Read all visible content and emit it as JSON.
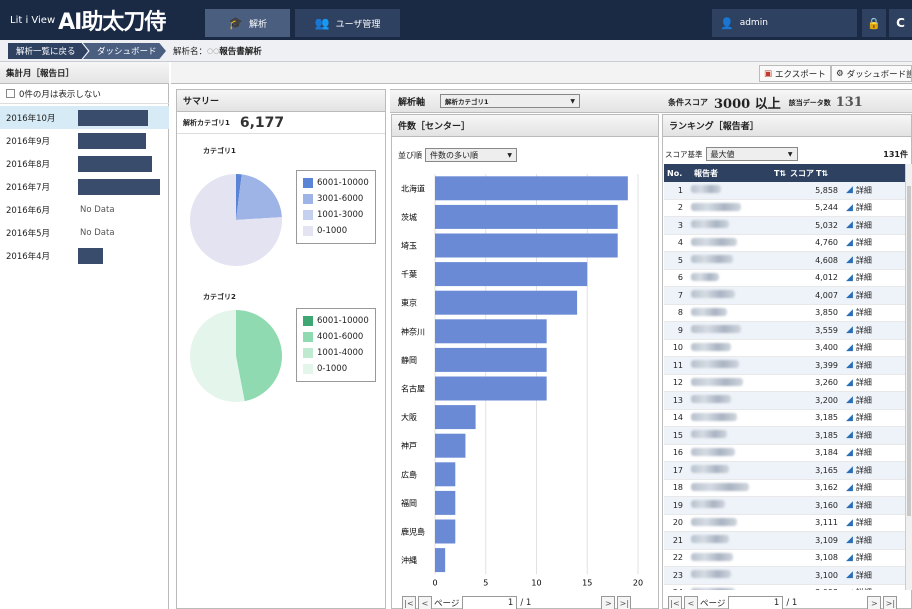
{
  "header": {
    "logo_prefix": "Lit i View",
    "logo_main": "AI助太刀侍",
    "nav": [
      {
        "label": "解析"
      },
      {
        "label": "ユーザ管理"
      }
    ],
    "user": "admin"
  },
  "breadcrumb": {
    "back": "解析一覧に戻る",
    "dashboard": "ダッシュボード",
    "analysis_name_label": "解析名：",
    "analysis_name_prefix": "○○",
    "analysis_name": "報告書解析"
  },
  "left": {
    "header": "集計月［報告日］",
    "hide_zero_label": "0件の月は表示しない",
    "months": [
      {
        "label": "2016年10月",
        "selected": true,
        "no_data": false
      },
      {
        "label": "2016年9月",
        "selected": false,
        "no_data": false
      },
      {
        "label": "2016年8月",
        "selected": false,
        "no_data": false
      },
      {
        "label": "2016年7月",
        "selected": false,
        "no_data": false
      },
      {
        "label": "2016年6月",
        "selected": false,
        "no_data": true,
        "nd_text": "No Data"
      },
      {
        "label": "2016年5月",
        "selected": false,
        "no_data": true,
        "nd_text": "No Data"
      },
      {
        "label": "2016年4月",
        "selected": false,
        "no_data": false
      }
    ]
  },
  "toolbar": {
    "export_label": "エクスポート",
    "dashboard_settings_label": "ダッシュボード設定"
  },
  "summary": {
    "title": "サマリー",
    "category_label": "解析カテゴリ1",
    "count": "6,177",
    "pie1": {
      "label": "カテゴリ1",
      "legend": [
        {
          "label": "6001-10000",
          "color": "#5b83d6"
        },
        {
          "label": "3001-6000",
          "color": "#9fb4e6"
        },
        {
          "label": "1001-3000",
          "color": "#c5cfee"
        },
        {
          "label": "0-1000",
          "color": "#e3e3f2"
        }
      ],
      "values": [
        0.02,
        0.22,
        0.0,
        0.76
      ]
    },
    "pie2": {
      "label": "カテゴリ2",
      "legend": [
        {
          "label": "6001-10000",
          "color": "#3ea774"
        },
        {
          "label": "4001-6000",
          "color": "#8fdab1"
        },
        {
          "label": "1001-4000",
          "color": "#bfe9d1"
        },
        {
          "label": "0-1000",
          "color": "#e4f5eb"
        }
      ],
      "values": [
        0.0,
        0.47,
        0.0,
        0.53
      ]
    }
  },
  "axis": {
    "label": "解析軸",
    "selected": "解析カテゴリ1",
    "condition_label": "条件スコア",
    "condition_value": "3000 以上",
    "count_label": "該当データ数",
    "count_value": "131"
  },
  "chart_panel": {
    "title": "件数［センター］",
    "sort_label": "並び順",
    "sort_value": "件数の多い順"
  },
  "chart_data": {
    "type": "bar",
    "orientation": "horizontal",
    "categories": [
      "北海道",
      "茨城",
      "埼玉",
      "千葉",
      "東京",
      "神奈川",
      "静岡",
      "名古屋",
      "大阪",
      "神戸",
      "広島",
      "福岡",
      "鹿児島",
      "沖縄"
    ],
    "values": [
      19,
      18,
      18,
      15,
      14,
      11,
      11,
      11,
      4,
      3,
      2,
      2,
      2,
      1
    ],
    "color": "#6b8ad6",
    "xlim": [
      0,
      20
    ],
    "xticks": [
      0,
      5,
      10,
      15,
      20
    ]
  },
  "pager1": {
    "page_label": "ページ",
    "page": "1",
    "total": "/ 1"
  },
  "ranking": {
    "title": "ランキング［報告者］",
    "score_basis_label": "スコア基準",
    "score_basis_value": "最大値",
    "total": "131件",
    "col_no": "No.",
    "col_reporter": "報告者",
    "col_score": "スコア",
    "detail_label": "詳細",
    "rows": [
      {
        "no": "1",
        "score": "5,858"
      },
      {
        "no": "2",
        "score": "5,244"
      },
      {
        "no": "3",
        "score": "5,032"
      },
      {
        "no": "4",
        "score": "4,760"
      },
      {
        "no": "5",
        "score": "4,608"
      },
      {
        "no": "6",
        "score": "4,012"
      },
      {
        "no": "7",
        "score": "4,007"
      },
      {
        "no": "8",
        "score": "3,850"
      },
      {
        "no": "9",
        "score": "3,559"
      },
      {
        "no": "10",
        "score": "3,400"
      },
      {
        "no": "11",
        "score": "3,399"
      },
      {
        "no": "12",
        "score": "3,260"
      },
      {
        "no": "13",
        "score": "3,200"
      },
      {
        "no": "14",
        "score": "3,185"
      },
      {
        "no": "15",
        "score": "3,185"
      },
      {
        "no": "16",
        "score": "3,184"
      },
      {
        "no": "17",
        "score": "3,165"
      },
      {
        "no": "18",
        "score": "3,162"
      },
      {
        "no": "19",
        "score": "3,160"
      },
      {
        "no": "20",
        "score": "3,111"
      },
      {
        "no": "21",
        "score": "3,109"
      },
      {
        "no": "22",
        "score": "3,108"
      },
      {
        "no": "23",
        "score": "3,100"
      },
      {
        "no": "24",
        "score": "3,098"
      }
    ]
  },
  "pager2": {
    "page_label": "ページ",
    "page": "1",
    "total": "/ 1"
  }
}
